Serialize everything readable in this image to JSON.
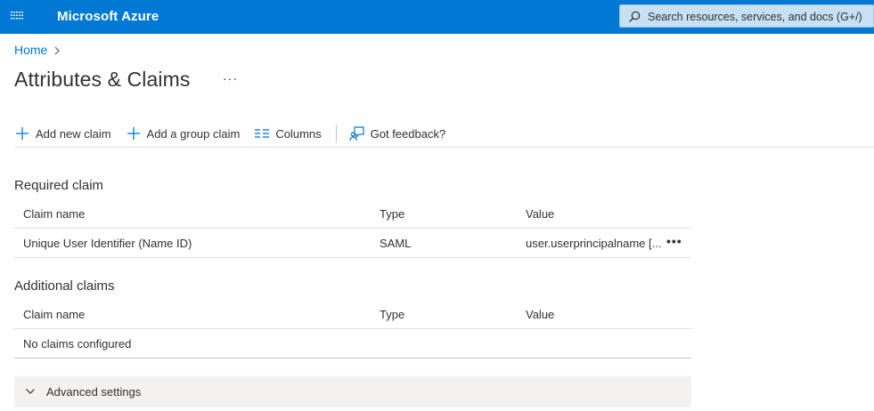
{
  "app": {
    "title": "Microsoft Azure"
  },
  "search": {
    "placeholder": "Search resources, services, and docs (G+/)"
  },
  "breadcrumb": {
    "home": "Home"
  },
  "page": {
    "title": "Attributes & Claims",
    "more": "···"
  },
  "toolbar": {
    "add_new_claim": "Add new claim",
    "add_group_claim": "Add a group claim",
    "columns": "Columns",
    "feedback": "Got feedback?"
  },
  "required": {
    "title": "Required claim",
    "headers": [
      "Claim name",
      "Type",
      "Value"
    ],
    "rows": [
      {
        "name": "Unique User Identifier (Name ID)",
        "type": "SAML",
        "value": "user.userprincipalname [..."
      }
    ],
    "row_more": "•••"
  },
  "additional": {
    "title": "Additional claims",
    "headers": [
      "Claim name",
      "Type",
      "Value"
    ],
    "empty": "No claims configured"
  },
  "advanced": {
    "label": "Advanced settings"
  },
  "icons": {
    "menu": "hamburger-icon",
    "search": "search-icon",
    "breadcrumb": "chevron-right-icon",
    "add": "plus-icon",
    "columns": "columns-icon",
    "feedback": "feedback-icon",
    "advanced": "chevron-down-icon"
  },
  "colors": {
    "brand": "#0078d4",
    "link": "#0078d4",
    "search_bg": "#c7e0f4",
    "panel_bg": "#f3f2f1"
  }
}
